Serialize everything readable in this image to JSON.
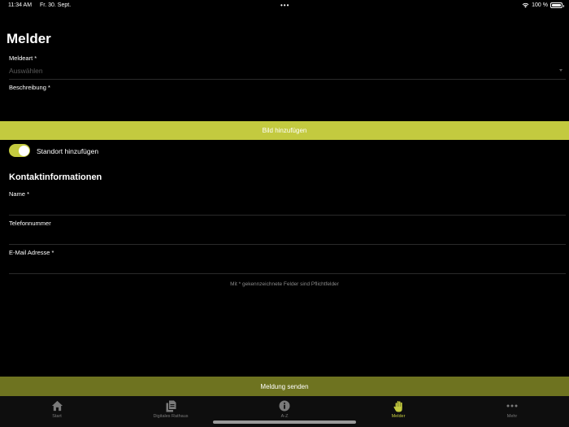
{
  "status_bar": {
    "time": "11:34 AM",
    "date": "Fr. 30. Sept.",
    "dots": "•••",
    "battery_percent": "100 %"
  },
  "page": {
    "title": "Melder"
  },
  "form": {
    "type_label": "Meldeart *",
    "type_placeholder": "Auswählen",
    "description_label": "Beschreibung *",
    "add_image_label": "Bild hinzufügen",
    "location_toggle_label": "Standort hinzufügen",
    "location_toggle_on": true
  },
  "contact": {
    "title": "Kontaktinformationen",
    "name_label": "Name *",
    "phone_label": "Telefonnummer",
    "email_label": "E-Mail Adresse *"
  },
  "note": "Mit * gekennzeichnete Felder sind Pflichtfelder",
  "send_label": "Meldung senden",
  "tabs": [
    {
      "label": "Start",
      "icon": "house-icon"
    },
    {
      "label": "Digitales Rathaus",
      "icon": "documents-icon"
    },
    {
      "label": "A-Z",
      "icon": "info-icon"
    },
    {
      "label": "Melder",
      "icon": "hand-icon",
      "active": true
    },
    {
      "label": "Mehr",
      "icon": "more-dots-icon"
    }
  ],
  "colors": {
    "accent": "#c3ca3f",
    "send_button": "#6e7320",
    "background": "#000000"
  }
}
